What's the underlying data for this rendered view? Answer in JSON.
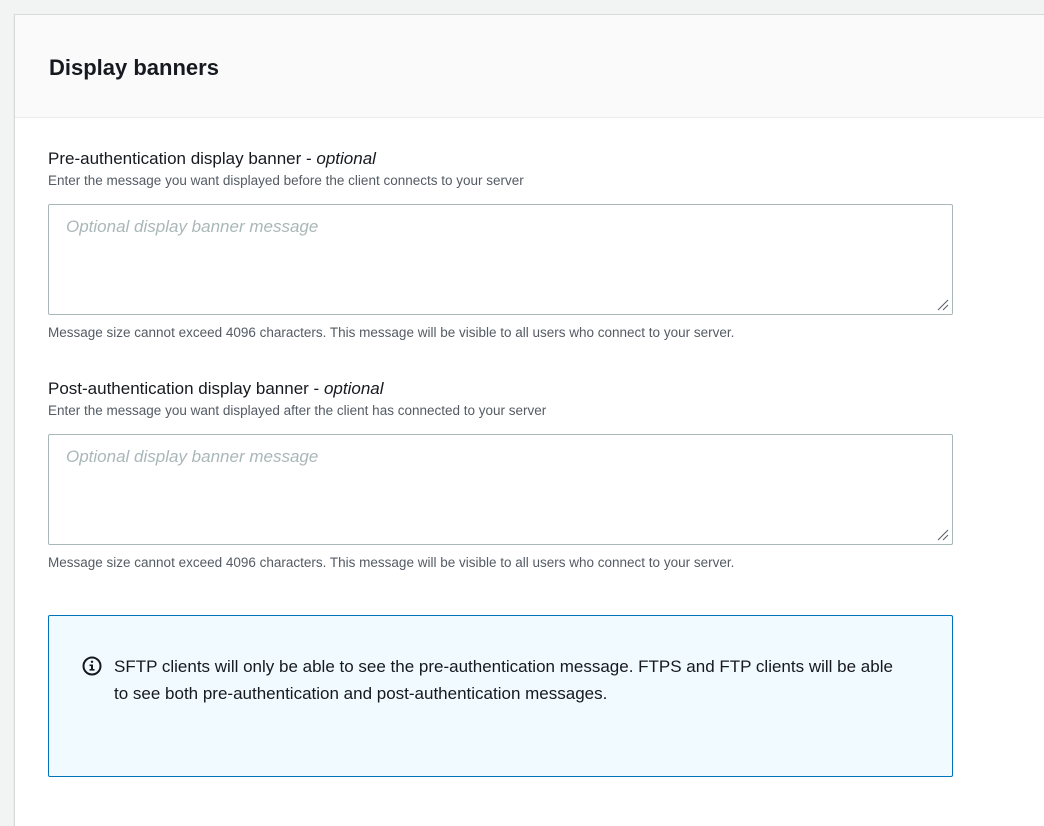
{
  "panel": {
    "title": "Display banners"
  },
  "pre_auth": {
    "label": "Pre-authentication display banner - ",
    "optional_tag": "optional",
    "description": "Enter the message you want displayed before the client connects to your server",
    "placeholder": "Optional display banner message",
    "value": "",
    "constraint": "Message size cannot exceed 4096 characters. This message will be visible to all users who connect to your server."
  },
  "post_auth": {
    "label": "Post-authentication display banner - ",
    "optional_tag": "optional",
    "description": "Enter the message you want displayed after the client has connected to your server",
    "placeholder": "Optional display banner message",
    "value": "",
    "constraint": "Message size cannot exceed 4096 characters. This message will be visible to all users who connect to your server."
  },
  "info_alert": {
    "icon": "info-circle-icon",
    "text": "SFTP clients will only be able to see the pre-authentication message. FTPS and FTP clients will be able to see both pre-authentication and post-authentication messages."
  },
  "colors": {
    "info_border": "#0073bb",
    "info_background": "#f1faff",
    "input_border": "#aab7b8",
    "placeholder": "#aab7b8"
  }
}
